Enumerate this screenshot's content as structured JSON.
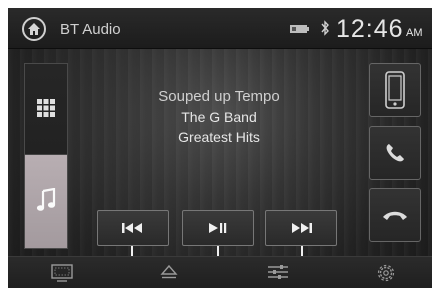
{
  "header": {
    "source_title": "BT Audio",
    "clock_time": "12:46",
    "clock_ampm": "AM",
    "icons": [
      "home-icon",
      "phone-battery-icon",
      "bluetooth-icon"
    ]
  },
  "track": {
    "song": "Souped up Tempo",
    "artist": "The G Band",
    "album": "Greatest Hits"
  },
  "left_panel": {
    "items": [
      {
        "name": "apps-grid",
        "icon": "grid-icon"
      },
      {
        "name": "music",
        "icon": "music-note-icon",
        "active": true
      }
    ]
  },
  "right_panel": {
    "items": [
      {
        "name": "phone-device",
        "icon": "smartphone-icon"
      },
      {
        "name": "call",
        "icon": "handset-icon"
      },
      {
        "name": "end-call",
        "icon": "hang-up-icon"
      }
    ]
  },
  "transport": {
    "buttons": [
      {
        "name": "previous-track",
        "icon": "skip-back-icon"
      },
      {
        "name": "play-pause",
        "icon": "play-pause-icon"
      },
      {
        "name": "next-track",
        "icon": "skip-forward-icon"
      }
    ]
  },
  "bottom_bar": {
    "icons": [
      "display-icon",
      "eject-icon",
      "equalizer-icon",
      "settings-gear-icon"
    ]
  },
  "colors": {
    "background": "#2a2a2a",
    "text": "#e6e6e6",
    "active_tab": "#b0a6aa",
    "border": "#777777"
  }
}
